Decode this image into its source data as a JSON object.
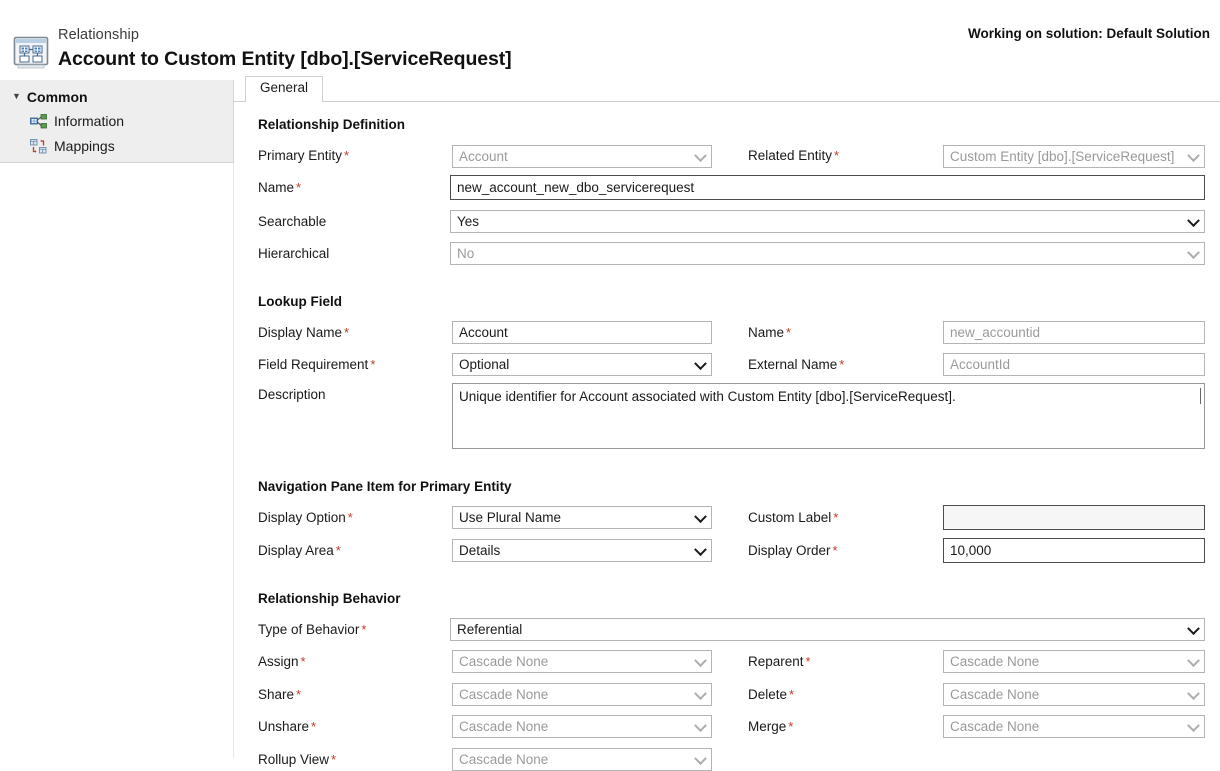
{
  "header": {
    "kicker": "Relationship",
    "title": "Account to Custom Entity [dbo].[ServiceRequest]",
    "solution_note": "Working on solution: Default Solution",
    "icon": "relationship-entity-icon"
  },
  "sidebar": {
    "group_label": "Common",
    "items": [
      {
        "label": "Information",
        "icon": "information-relationship-icon"
      },
      {
        "label": "Mappings",
        "icon": "mappings-icon"
      }
    ]
  },
  "tabs": [
    {
      "label": "General",
      "selected": true
    }
  ],
  "sections": {
    "relationship_definition": {
      "title": "Relationship Definition",
      "primary_entity": {
        "label": "Primary Entity",
        "required": "*",
        "value": "Account",
        "type": "select",
        "disabled": true
      },
      "related_entity": {
        "label": "Related Entity",
        "required": "*",
        "value": "Custom Entity [dbo].[ServiceRequest]",
        "type": "select",
        "disabled": true
      },
      "name": {
        "label": "Name",
        "required": "*",
        "value": "new_account_new_dbo_servicerequest",
        "type": "text",
        "disabled": false
      },
      "searchable": {
        "label": "Searchable",
        "required": "",
        "value": "Yes",
        "type": "select",
        "disabled": false
      },
      "hierarchical": {
        "label": "Hierarchical",
        "required": "",
        "value": "No",
        "type": "select",
        "disabled": true
      }
    },
    "lookup_field": {
      "title": "Lookup Field",
      "display_name": {
        "label": "Display Name",
        "required": "*",
        "value": "Account",
        "type": "text",
        "disabled": false
      },
      "name": {
        "label": "Name",
        "required": "*",
        "value": "new_accountid",
        "type": "text",
        "disabled": true
      },
      "field_requirement": {
        "label": "Field Requirement",
        "required": "*",
        "value": "Optional",
        "type": "select",
        "disabled": false
      },
      "external_name": {
        "label": "External Name",
        "required": "*",
        "value": "AccountId",
        "type": "text",
        "disabled": true
      },
      "description": {
        "label": "Description",
        "required": "",
        "value": "Unique identifier for Account associated with Custom Entity [dbo].[ServiceRequest].",
        "type": "textarea",
        "disabled": false
      }
    },
    "navigation_pane": {
      "title": "Navigation Pane Item for Primary Entity",
      "display_option": {
        "label": "Display Option",
        "required": "*",
        "value": "Use Plural Name",
        "type": "select",
        "disabled": false
      },
      "custom_label": {
        "label": "Custom Label",
        "required": "*",
        "value": "",
        "type": "text",
        "disabled": true
      },
      "display_area": {
        "label": "Display Area",
        "required": "*",
        "value": "Details",
        "type": "select",
        "disabled": false
      },
      "display_order": {
        "label": "Display Order",
        "required": "*",
        "value": "10,000",
        "type": "text",
        "disabled": false
      }
    },
    "relationship_behavior": {
      "title": "Relationship Behavior",
      "type_of_behavior": {
        "label": "Type of Behavior",
        "required": "*",
        "value": "Referential",
        "type": "select",
        "disabled": false
      },
      "assign": {
        "label": "Assign",
        "required": "*",
        "value": "Cascade None",
        "type": "select",
        "disabled": true
      },
      "reparent": {
        "label": "Reparent",
        "required": "*",
        "value": "Cascade None",
        "type": "select",
        "disabled": true
      },
      "share": {
        "label": "Share",
        "required": "*",
        "value": "Cascade None",
        "type": "select",
        "disabled": true
      },
      "delete": {
        "label": "Delete",
        "required": "*",
        "value": "Cascade None",
        "type": "select",
        "disabled": true
      },
      "unshare": {
        "label": "Unshare",
        "required": "*",
        "value": "Cascade None",
        "type": "select",
        "disabled": true
      },
      "merge": {
        "label": "Merge",
        "required": "*",
        "value": "Cascade None",
        "type": "select",
        "disabled": true
      },
      "rollup_view": {
        "label": "Rollup View",
        "required": "*",
        "value": "Cascade None",
        "type": "select",
        "disabled": true
      }
    }
  },
  "colors": {
    "required_marker": "#c0392b",
    "sidebar_bg": "#eeeeee",
    "disabled_text": "#9a9a9a",
    "border": "#b4b4b4"
  }
}
